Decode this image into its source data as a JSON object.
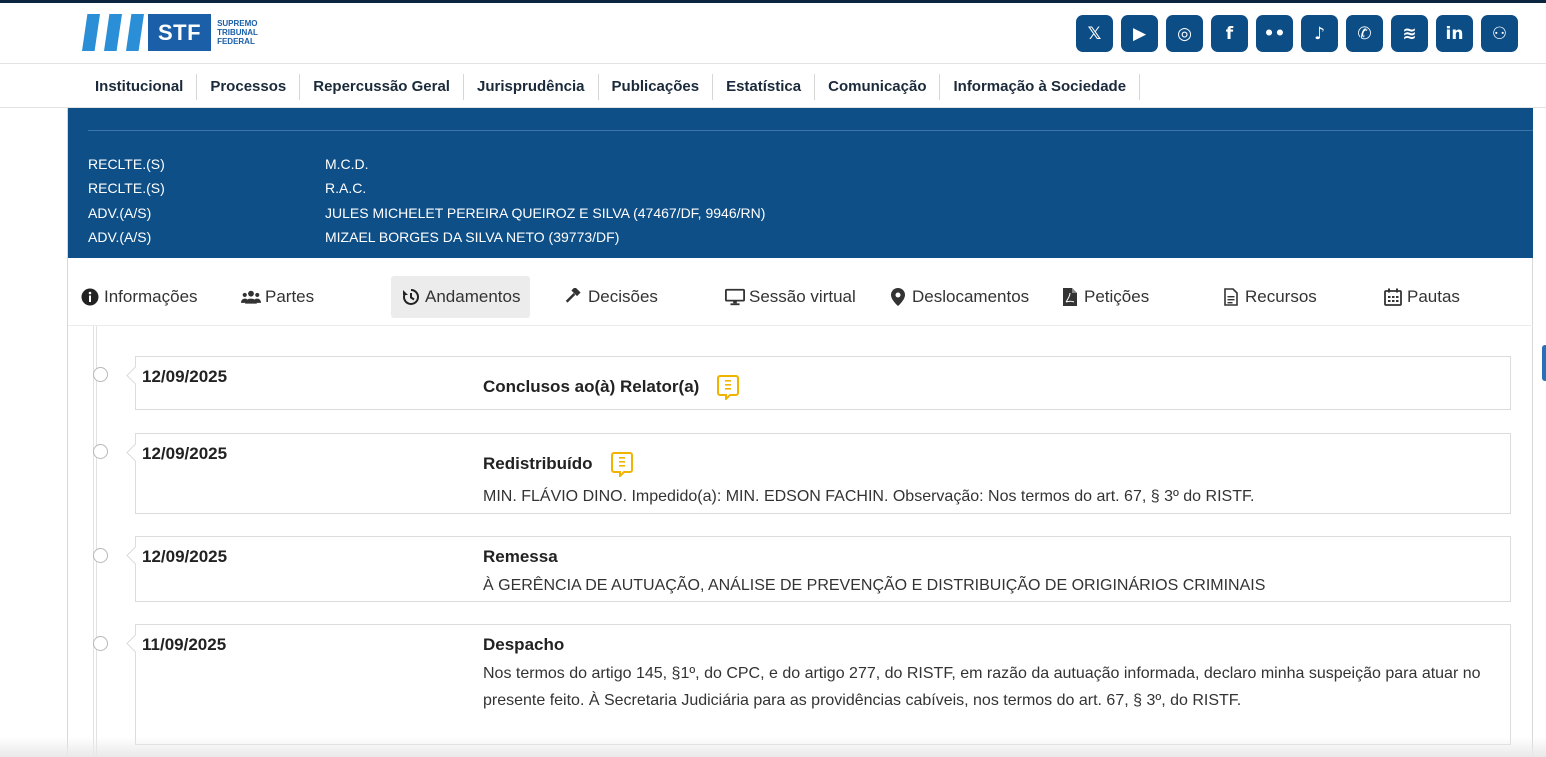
{
  "logo": {
    "short": "STF",
    "sub_line1": "SUPREMO",
    "sub_line2": "TRIBUNAL",
    "sub_line3": "FEDERAL"
  },
  "social": [
    {
      "icon": "x-icon",
      "glyph": "𝕏"
    },
    {
      "icon": "youtube-icon",
      "glyph": "▶"
    },
    {
      "icon": "instagram-icon",
      "glyph": "◎"
    },
    {
      "icon": "facebook-icon",
      "glyph": "f"
    },
    {
      "icon": "flickr-icon",
      "glyph": "••"
    },
    {
      "icon": "tiktok-icon",
      "glyph": "♪"
    },
    {
      "icon": "whatsapp-icon",
      "glyph": "✆"
    },
    {
      "icon": "spotify-icon",
      "glyph": "≋"
    },
    {
      "icon": "linkedin-icon",
      "glyph": "in"
    },
    {
      "icon": "podcast-icon",
      "glyph": "⚇"
    }
  ],
  "nav": [
    "Institucional",
    "Processos",
    "Repercussão Geral",
    "Jurisprudência",
    "Publicações",
    "Estatística",
    "Comunicação",
    "Informação à Sociedade"
  ],
  "parties": [
    {
      "role": "RECLTE.(S)",
      "name": "M.C.D."
    },
    {
      "role": "RECLTE.(S)",
      "name": "R.A.C."
    },
    {
      "role": "ADV.(A/S)",
      "name": "JULES MICHELET PEREIRA QUEIROZ E SILVA (47467/DF, 9946/RN)"
    },
    {
      "role": "ADV.(A/S)",
      "name": "MIZAEL BORGES DA SILVA NETO (39773/DF)"
    }
  ],
  "tabs": [
    {
      "label": "Informações",
      "icon": "info-icon",
      "glyph": "ℹ"
    },
    {
      "label": "Partes",
      "icon": "users-icon",
      "glyph": "👥"
    },
    {
      "label": "Andamentos",
      "icon": "history-icon",
      "glyph": "↺",
      "active": true
    },
    {
      "label": "Decisões",
      "icon": "gavel-icon",
      "glyph": "⚒"
    },
    {
      "label": "Sessão virtual",
      "icon": "monitor-icon",
      "glyph": "🖵"
    },
    {
      "label": "Deslocamentos",
      "icon": "map-pin-icon",
      "glyph": "⚲"
    },
    {
      "label": "Petições",
      "icon": "pdf-file-icon",
      "glyph": "🗎"
    },
    {
      "label": "Recursos",
      "icon": "file-text-icon",
      "glyph": "🗏"
    },
    {
      "label": "Pautas",
      "icon": "calendar-icon",
      "glyph": "▦"
    }
  ],
  "entries": [
    {
      "date": "12/09/2025",
      "title": "Conclusos ao(à) Relator(a)",
      "has_doc": true,
      "desc": ""
    },
    {
      "date": "12/09/2025",
      "title": "Redistribuído",
      "has_doc": true,
      "desc": "MIN. FLÁVIO DINO. Impedido(a): MIN. EDSON FACHIN. Observação: Nos termos do art. 67, § 3º do RISTF."
    },
    {
      "date": "12/09/2025",
      "title": "Remessa",
      "has_doc": false,
      "desc": "À GERÊNCIA DE AUTUAÇÃO, ANÁLISE DE PREVENÇÃO E DISTRIBUIÇÃO DE ORIGINÁRIOS CRIMINAIS"
    },
    {
      "date": "11/09/2025",
      "title": "Despacho",
      "has_doc": false,
      "desc": "Nos termos do artigo 145, §1º, do CPC, e do artigo 277, do RISTF, em razão da autuação informada, declaro minha suspeição para atuar no presente feito. À Secretaria Judiciária para as providências cabíveis, nos termos do art. 67, § 3º, do RISTF."
    }
  ],
  "colors": {
    "brand_blue": "#0e4f88",
    "social_blue": "#0d4d86",
    "doc_icon": "#f0b400"
  }
}
